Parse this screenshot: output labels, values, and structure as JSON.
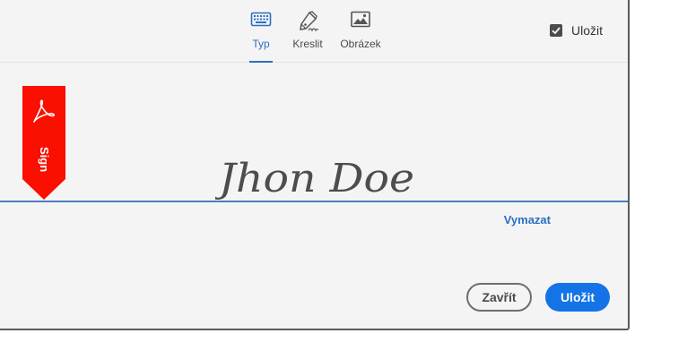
{
  "tabs": [
    {
      "label": "Typ",
      "icon": "keyboard-icon",
      "active": true
    },
    {
      "label": "Kreslit",
      "icon": "pen-draw-icon",
      "active": false
    },
    {
      "label": "Obrázek",
      "icon": "image-icon",
      "active": false
    }
  ],
  "save_checkbox": {
    "label": "Uložit",
    "checked": true
  },
  "ribbon": {
    "text": "Sign",
    "icon": "acrobat-logo-icon",
    "color": "#fa0f00"
  },
  "signature": {
    "text": "Jhon Doe"
  },
  "clear_label": "Vymazat",
  "buttons": {
    "close_label": "Zavřít",
    "save_label": "Uložit"
  },
  "colors": {
    "accent": "#1473e6",
    "link": "#2c6fc1",
    "line": "#4a7fc1",
    "background": "#f4f4f4"
  }
}
